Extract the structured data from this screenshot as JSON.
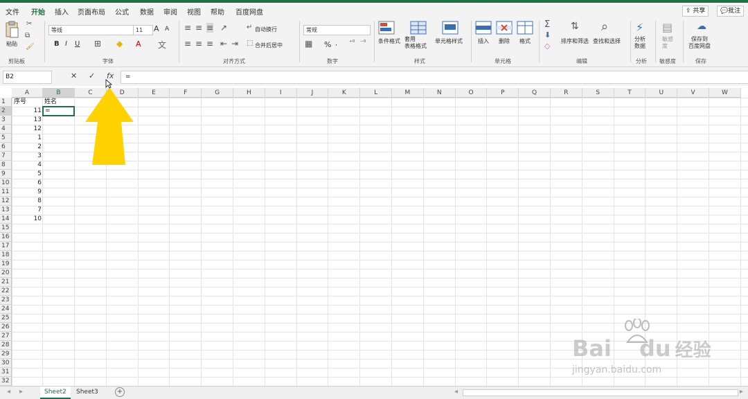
{
  "ribbon_tabs": [
    "文件",
    "开始",
    "插入",
    "页面布局",
    "公式",
    "数据",
    "审阅",
    "视图",
    "帮助",
    "百度网盘"
  ],
  "share_label": "共享",
  "comment_label": "批注",
  "clipboard": {
    "paste": "粘贴",
    "group": "剪贴板"
  },
  "font": {
    "name": "等线",
    "size": "11",
    "group": "字体",
    "bold": "B",
    "italic": "I",
    "underline": "U",
    "grow": "A",
    "shrink": "A"
  },
  "alignment": {
    "wrap": "自动换行",
    "merge": "合并后居中",
    "group": "对齐方式"
  },
  "number": {
    "format": "常规",
    "percent": "%",
    "group": "数字"
  },
  "styles": {
    "cond": "条件格式",
    "table": "套用\n表格格式",
    "cell": "单元格样式",
    "group": "样式"
  },
  "cells": {
    "insert": "插入",
    "delete": "删除",
    "format": "格式",
    "group": "单元格"
  },
  "editing": {
    "sort": "排序和筛选",
    "find": "查找和选择",
    "group": "编辑"
  },
  "analysis": {
    "label": "分析\n数据",
    "group": "分析"
  },
  "sensitivity": {
    "label": "敏感度",
    "sub": "敏感\n度"
  },
  "save": {
    "label": "保存到\n百度网盘",
    "group": "保存"
  },
  "formula_bar": {
    "name_box": "B2",
    "cancel": "✕",
    "enter": "✓",
    "fx": "fx",
    "content": "="
  },
  "columns": [
    "A",
    "B",
    "C",
    "D",
    "E",
    "F",
    "G",
    "H",
    "I",
    "J",
    "K",
    "L",
    "M",
    "N",
    "O",
    "P",
    "Q",
    "R",
    "S",
    "T",
    "U",
    "V",
    "W"
  ],
  "rows": [
    "1",
    "2",
    "3",
    "4",
    "5",
    "6",
    "7",
    "8",
    "9",
    "10",
    "11",
    "12",
    "13",
    "14",
    "15",
    "16",
    "17",
    "18",
    "19",
    "20",
    "21",
    "22",
    "23",
    "24",
    "25",
    "26",
    "27",
    "28",
    "29",
    "30",
    "31",
    "32"
  ],
  "cells_data": {
    "A1": "序号",
    "B1": "姓名",
    "A": [
      "11",
      "13",
      "12",
      "1",
      "2",
      "3",
      "4",
      "5",
      "6",
      "9",
      "8",
      "7",
      "10"
    ],
    "B2": "="
  },
  "active_cell": "B2",
  "sheets": [
    "Sheet2",
    "Sheet3"
  ],
  "watermark": {
    "brand": "Bai",
    "brand2": "du",
    "cn": "经验",
    "url": "jingyan.baidu.com"
  },
  "colors": {
    "excel_green": "#1e7145",
    "arrow": "#ffd200"
  }
}
